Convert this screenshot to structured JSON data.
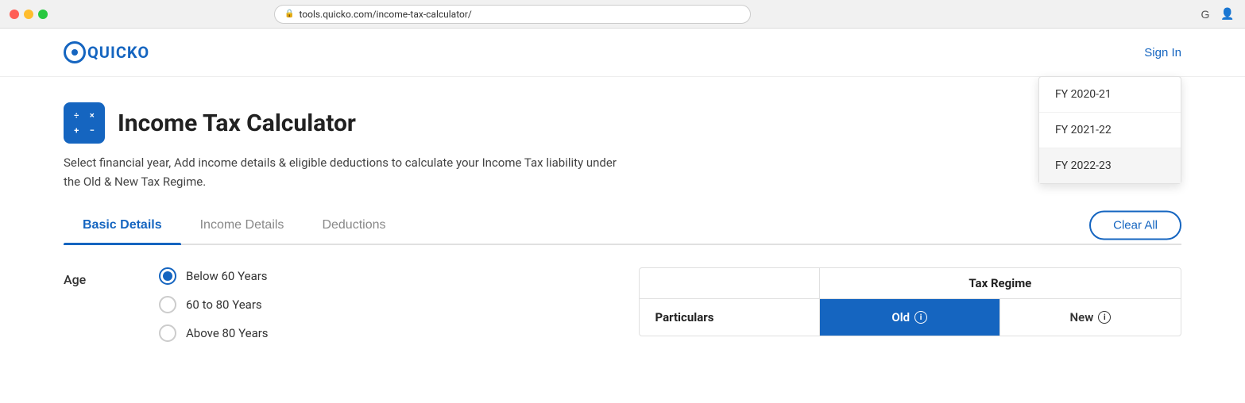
{
  "browser": {
    "url": "tools.quicko.com/income-tax-calculator/",
    "lock_symbol": "🔒"
  },
  "header": {
    "logo_text": "QUICKO",
    "sign_in_label": "Sign In"
  },
  "fy_dropdown": {
    "options": [
      {
        "id": "fy2020",
        "label": "FY 2020-21",
        "selected": false
      },
      {
        "id": "fy2021",
        "label": "FY 2021-22",
        "selected": false
      },
      {
        "id": "fy2022",
        "label": "FY 2022-23",
        "selected": true
      }
    ]
  },
  "hero": {
    "title": "Income Tax Calculator",
    "description": "Select financial year, Add income details & eligible deductions to calculate your Income Tax liability under the Old & New Tax Regime.",
    "calc_cells": [
      "÷",
      "×",
      "+",
      "−"
    ]
  },
  "tabs": [
    {
      "id": "basic",
      "label": "Basic Details",
      "active": true
    },
    {
      "id": "income",
      "label": "Income Details",
      "active": false
    },
    {
      "id": "deductions",
      "label": "Deductions",
      "active": false
    }
  ],
  "clear_all": "Clear All",
  "age_section": {
    "label": "Age",
    "options": [
      {
        "id": "below60",
        "label": "Below 60 Years",
        "checked": true
      },
      {
        "id": "60to80",
        "label": "60 to 80 Years",
        "checked": false
      },
      {
        "id": "above80",
        "label": "Above 80 Years",
        "checked": false
      }
    ]
  },
  "regime_table": {
    "header_right": "Tax Regime",
    "particulars_label": "Particulars",
    "old_label": "Old",
    "new_label": "New",
    "info_symbol": "ℹ"
  }
}
